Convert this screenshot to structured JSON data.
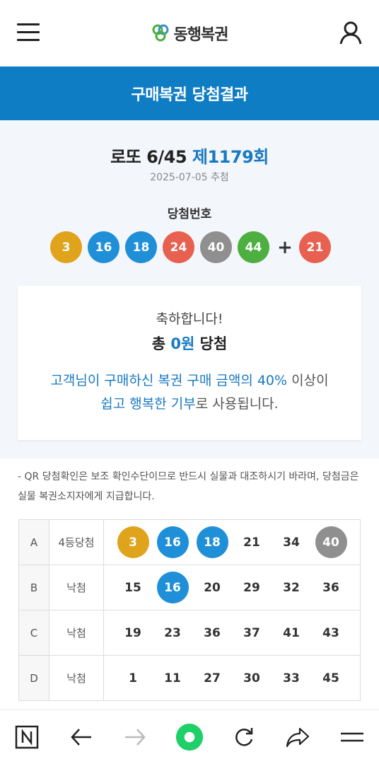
{
  "header": {
    "logo_text": "동행복권"
  },
  "titlebar": {
    "title": "구매복권 당첨결과"
  },
  "draw": {
    "game": "로또 6/45",
    "round": "제1179회",
    "date": "2025-07-05 추첨",
    "winning_label": "당첨번호",
    "numbers": [
      "3",
      "16",
      "18",
      "24",
      "40",
      "44"
    ],
    "plus": "+",
    "bonus": "21"
  },
  "card": {
    "congrats": "축하합니다!",
    "total_prefix": "총",
    "total_amount": "0원",
    "total_suffix": "당첨",
    "donate_hl1": "고객님이 구매하신 복권 구매 금액의 40%",
    "donate_txt1": " 이상이",
    "donate_hl2": "쉽고 행복한 기부",
    "donate_txt2": "로 사용됩니다."
  },
  "notice": "- QR 당첨확인은 보조 확인수단이므로 반드시 실물과 대조하시기 바라며, 당첨금은 실물 복권소지자에게 지급합니다.",
  "rows": [
    {
      "label": "A",
      "status": "4등당첨",
      "nums": [
        "3",
        "16",
        "18",
        "21",
        "34",
        "40"
      ]
    },
    {
      "label": "B",
      "status": "낙첨",
      "nums": [
        "15",
        "16",
        "20",
        "29",
        "32",
        "36"
      ]
    },
    {
      "label": "C",
      "status": "낙첨",
      "nums": [
        "19",
        "23",
        "36",
        "37",
        "41",
        "43"
      ]
    },
    {
      "label": "D",
      "status": "낙첨",
      "nums": [
        "1",
        "11",
        "27",
        "30",
        "33",
        "45"
      ]
    }
  ],
  "colors": {
    "brand_blue": "#0f7dc4",
    "ball_yellow": "#e0a31c",
    "ball_blue": "#1f8fd8",
    "ball_red": "#e8604f",
    "ball_gray": "#8f8f8f",
    "ball_green": "#4caf3f"
  }
}
